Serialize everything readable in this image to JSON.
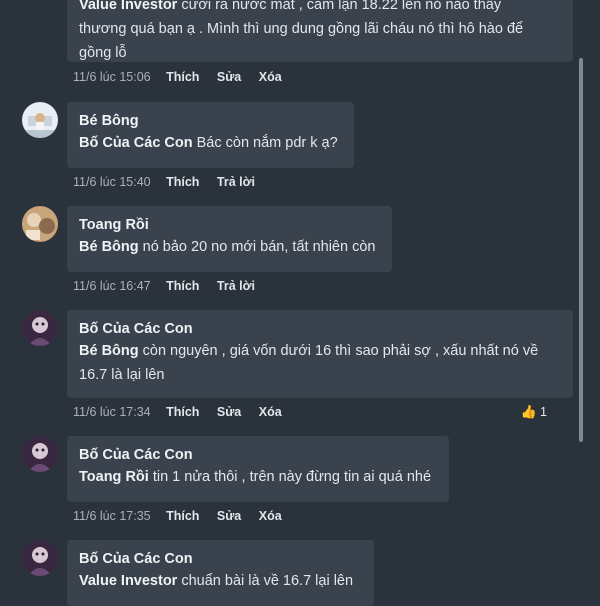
{
  "comments": [
    {
      "author": "Value Investor",
      "text_top": "cười ra nước mắt , cắm lận 18.22 lên nó nào thấy",
      "lines": [
        "thương quá bạn ạ . Mình thì ung dung gồng lãi cháu nó thì hô hào để",
        "gồng lỗ"
      ],
      "time": "11/6 lúc 15:06",
      "actions": [
        "Thích",
        "Sửa",
        "Xóa"
      ]
    },
    {
      "author": "Bé Bông",
      "mention": "Bố Của Các Con",
      "text": "Bác còn nắm pdr k ạ?",
      "time": "11/6 lúc 15:40",
      "actions": [
        "Thích",
        "Trả lời"
      ]
    },
    {
      "author": "Toang Rồi",
      "mention": "Bé Bông",
      "text": "nó bảo 20 no mới bán, tất nhiên còn",
      "time": "11/6 lúc 16:47",
      "actions": [
        "Thích",
        "Trả lời"
      ]
    },
    {
      "author": "Bố Của Các Con",
      "mention": "Bé Bông",
      "text": "còn nguyên , giá vốn dưới 16 thì sao phải sợ , xấu nhất nó về",
      "text2": "16.7 là lại lên",
      "time": "11/6 lúc 17:34",
      "actions": [
        "Thích",
        "Sửa",
        "Xóa"
      ],
      "likes": "1"
    },
    {
      "author": "Bố Của Các Con",
      "mention": "Toang Rồi",
      "text": "tin 1 nửa thôi , trên này đừng tin ai quá nhé",
      "time": "11/6 lúc 17:35",
      "actions": [
        "Thích",
        "Sửa",
        "Xóa"
      ]
    },
    {
      "author": "Bố Của Các Con",
      "mention": "Value Investor",
      "text": " chuẩn bài là về 16.7 lại lên"
    }
  ],
  "colors": {
    "background": "#2a323b",
    "bubble": "#3a434d",
    "like_blue": "#4a90e2"
  },
  "icons": {
    "like": "thumbs-up-icon"
  }
}
